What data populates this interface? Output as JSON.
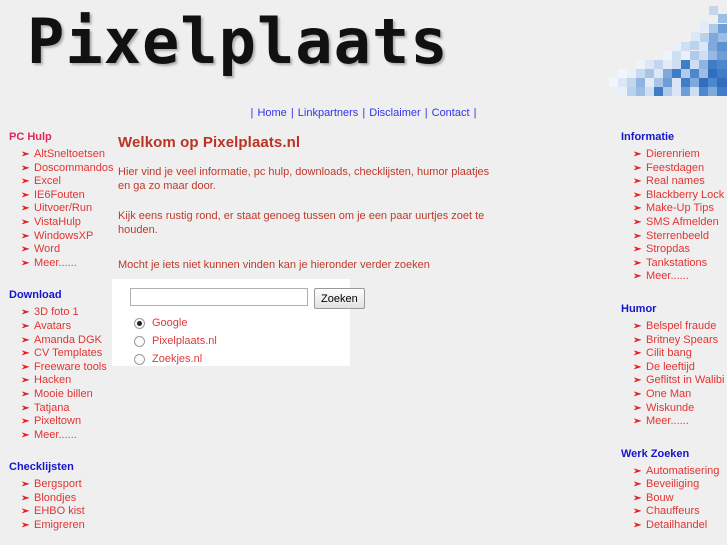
{
  "site": {
    "logo_text": "Pixelplaats",
    "logo_color": "#111111",
    "accent_red": "#e23434",
    "accent_blue": "#1515cc",
    "page_background": "#efefef",
    "mosaic_icon": "blue-pixel-mosaic-icon"
  },
  "nav": {
    "separator": "|",
    "items": [
      {
        "label": "Home"
      },
      {
        "label": "Linkpartners"
      },
      {
        "label": "Disclaimer"
      },
      {
        "label": "Contact"
      }
    ]
  },
  "main": {
    "heading": "Welkom op Pixelplaats.nl",
    "paragraph1": "Hier vind je veel informatie, pc hulp, downloads, checklijsten, humor plaatjes en ga zo maar door.",
    "paragraph2": "Kijk eens rustig rond, er staat genoeg tussen om je een paar uurtjes zoet te houden.",
    "search_prompt": "Mocht je iets niet kunnen vinden kan je hieronder verder zoeken",
    "search": {
      "value": "",
      "placeholder": "",
      "button_label": "Zoeken",
      "engines": [
        {
          "label": "Google",
          "selected": true
        },
        {
          "label": "Pixelplaats.nl",
          "selected": false
        },
        {
          "label": "Zoekjes.nl",
          "selected": false
        }
      ]
    }
  },
  "sidebar_left": {
    "blocks": [
      {
        "title": "PC Hulp",
        "title_color": "red",
        "items": [
          {
            "label": "AltSneltoetsen"
          },
          {
            "label": "Doscommandos"
          },
          {
            "label": "Excel"
          },
          {
            "label": "IE6Fouten"
          },
          {
            "label": "Uitvoer/Run"
          },
          {
            "label": "VistaHulp"
          },
          {
            "label": "WindowsXP"
          },
          {
            "label": "Word"
          },
          {
            "label": "Meer......"
          }
        ]
      },
      {
        "title": "Download",
        "title_color": "blue",
        "items": [
          {
            "label": "3D foto 1"
          },
          {
            "label": "Avatars"
          },
          {
            "label": "Amanda DGK"
          },
          {
            "label": "CV Templates"
          },
          {
            "label": "Freeware tools"
          },
          {
            "label": "Hacken"
          },
          {
            "label": "Mooie billen"
          },
          {
            "label": "Tatjana"
          },
          {
            "label": "Pixeltown"
          },
          {
            "label": "Meer......"
          }
        ]
      },
      {
        "title": "Checklijsten",
        "title_color": "blue",
        "items": [
          {
            "label": "Bergsport"
          },
          {
            "label": "Blondjes"
          },
          {
            "label": "EHBO kist"
          },
          {
            "label": "Emigreren"
          }
        ]
      }
    ]
  },
  "sidebar_right": {
    "blocks": [
      {
        "title": "Informatie",
        "title_color": "blue",
        "items": [
          {
            "label": "Dierenriem"
          },
          {
            "label": "Feestdagen"
          },
          {
            "label": "Real names"
          },
          {
            "label": "Blackberry Lock"
          },
          {
            "label": "Make-Up Tips"
          },
          {
            "label": "SMS Afmelden"
          },
          {
            "label": "Sterrenbeeld"
          },
          {
            "label": "Stropdas"
          },
          {
            "label": "Tankstations"
          },
          {
            "label": "Meer......"
          }
        ]
      },
      {
        "title": "Humor",
        "title_color": "blue",
        "items": [
          {
            "label": "Belspel fraude"
          },
          {
            "label": "Britney Spears"
          },
          {
            "label": "Cilit bang"
          },
          {
            "label": "De leeftijd"
          },
          {
            "label": "Geflitst in Walibi"
          },
          {
            "label": "One Man"
          },
          {
            "label": "Wiskunde"
          },
          {
            "label": "Meer......"
          }
        ]
      },
      {
        "title": "Werk Zoeken",
        "title_color": "blue",
        "items": [
          {
            "label": "Automatisering"
          },
          {
            "label": "Beveiliging"
          },
          {
            "label": "Bouw"
          },
          {
            "label": "Chauffeurs"
          },
          {
            "label": "Detailhandel"
          }
        ]
      }
    ]
  },
  "bullet_glyph": "➢"
}
